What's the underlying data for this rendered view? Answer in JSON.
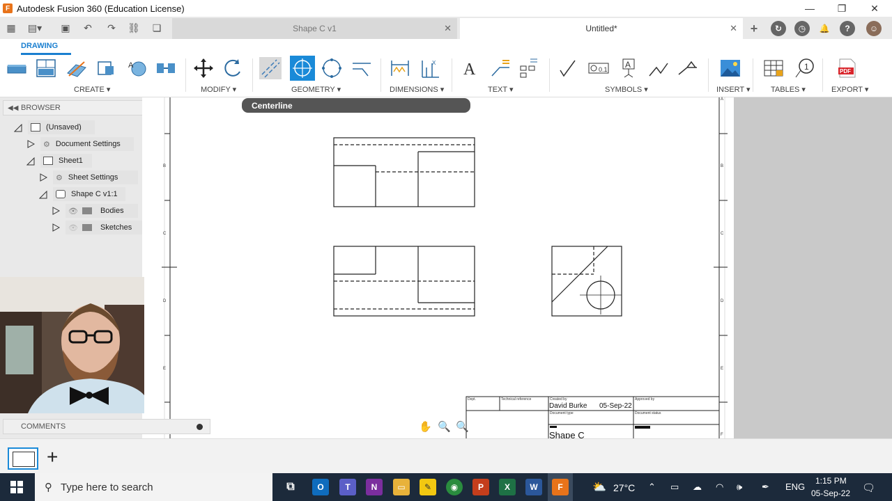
{
  "window": {
    "title": "Autodesk Fusion 360 (Education License)"
  },
  "tabs": [
    {
      "label": "Shape C v1",
      "active": false
    },
    {
      "label": "Untitled*",
      "active": true
    }
  ],
  "ribbon": {
    "workspace_tab": "DRAWING",
    "groups": [
      "CREATE ▾",
      "MODIFY ▾",
      "GEOMETRY ▾",
      "DIMENSIONS ▾",
      "TEXT ▾",
      "SYMBOLS ▾",
      "INSERT ▾",
      "TABLES ▾",
      "EXPORT ▾"
    ]
  },
  "tooltip": {
    "text": "Centerline"
  },
  "browser": {
    "header": "BROWSER",
    "nodes": [
      {
        "label": "(Unsaved)"
      },
      {
        "label": "Document Settings"
      },
      {
        "label": "Sheet1"
      },
      {
        "label": "Sheet Settings"
      },
      {
        "label": "Shape C v1:1"
      },
      {
        "label": "Bodies"
      },
      {
        "label": "Sketches"
      }
    ]
  },
  "comments": {
    "header": "COMMENTS"
  },
  "sheet": {
    "border_letters_left": [
      "B",
      "C",
      "D",
      "E"
    ],
    "border_letters_right": [
      "A",
      "B",
      "C",
      "D",
      "E",
      "F"
    ],
    "title_block": {
      "dept": "Dept.",
      "tech_ref": "Technical reference",
      "created_by_label": "Created by",
      "created_by": "David Burke",
      "date": "05-Sep-22",
      "approved_by_label": "Approved by",
      "doc_type_label": "Document type",
      "doc_status_label": "Document status",
      "title": "Shape C"
    }
  },
  "taskbar": {
    "search_placeholder": "Type here to search",
    "weather": "27°C",
    "lang": "ENG",
    "time": "1:15 PM",
    "date": "05-Sep-22"
  },
  "colors": {
    "accent": "#1a8ad8",
    "taskbar": "#1c2a3b"
  }
}
